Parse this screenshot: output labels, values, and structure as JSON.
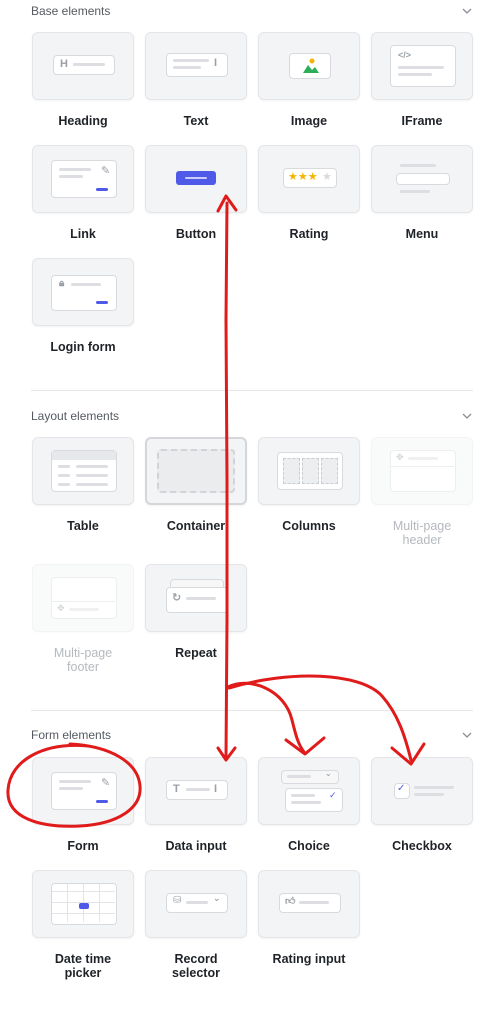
{
  "sections": {
    "base": {
      "title": "Base elements",
      "items": {
        "heading": "Heading",
        "text": "Text",
        "image": "Image",
        "iframe": "IFrame",
        "link": "Link",
        "button": "Button",
        "rating": "Rating",
        "menu": "Menu",
        "login_form": "Login form"
      }
    },
    "layout": {
      "title": "Layout elements",
      "items": {
        "table": "Table",
        "container": "Container",
        "columns": "Columns",
        "multipage_header": "Multi-page\nheader",
        "multipage_footer": "Multi-page\nfooter",
        "repeat": "Repeat"
      }
    },
    "form": {
      "title": "Form elements",
      "items": {
        "form": "Form",
        "data_input": "Data input",
        "choice": "Choice",
        "checkbox": "Checkbox",
        "date_time_picker": "Date time\npicker",
        "record_selector": "Record\nselector",
        "rating_input": "Rating input"
      }
    }
  },
  "colors": {
    "accent": "#4f5ae8",
    "annotation": "#e01b1b",
    "star": "#f5b400"
  },
  "icons": {
    "chevron": "chevron-down-icon",
    "heading": "H",
    "data_input": "T"
  }
}
